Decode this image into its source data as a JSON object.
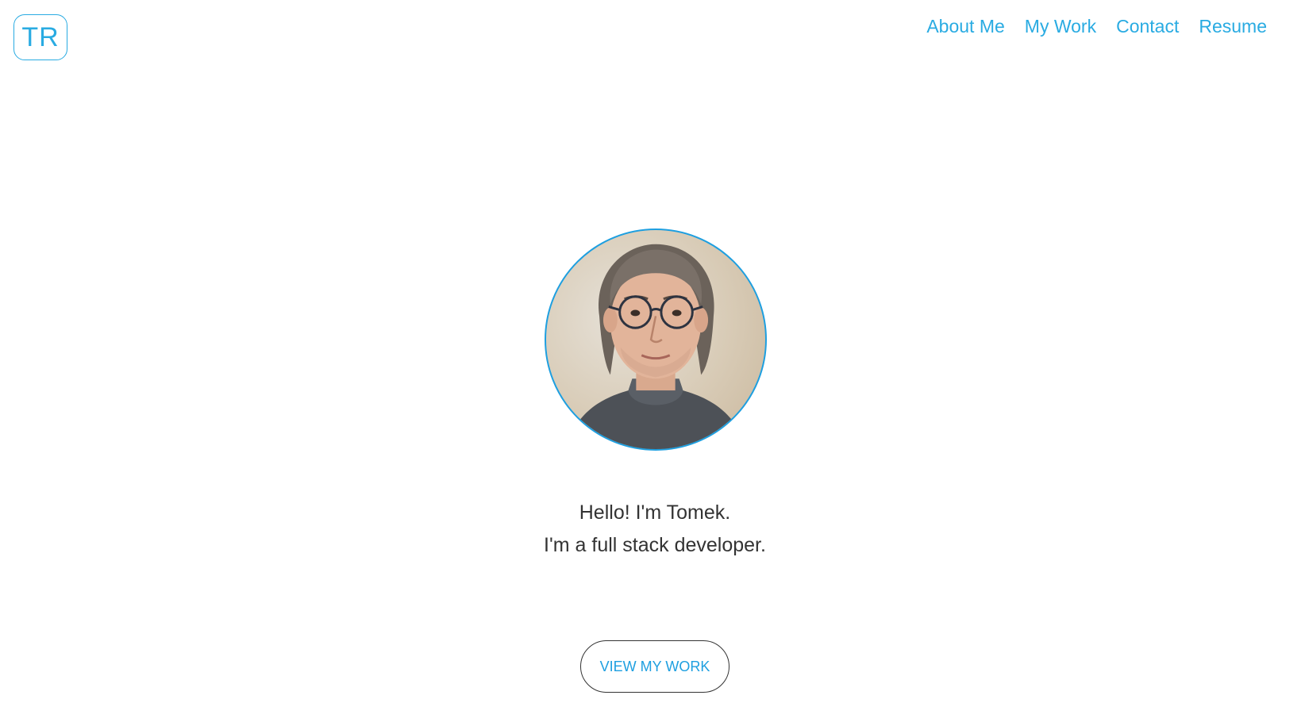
{
  "header": {
    "logo_text": "TR",
    "nav": [
      {
        "label": "About Me"
      },
      {
        "label": "My Work"
      },
      {
        "label": "Contact"
      },
      {
        "label": "Resume"
      }
    ]
  },
  "hero": {
    "greeting": "Hello! I'm Tomek.",
    "tagline": "I'm a full stack developer.",
    "cta_label": "VIEW MY WORK"
  },
  "colors": {
    "accent": "#29abe2",
    "text": "#333333",
    "background": "#ffffff"
  }
}
